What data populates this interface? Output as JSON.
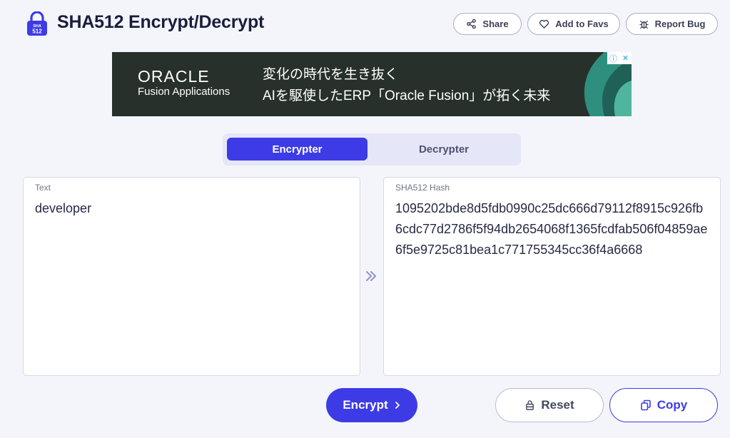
{
  "header": {
    "logo_text_top": "SHA",
    "logo_text_bottom": "512",
    "title": "SHA512 Encrypt/Decrypt",
    "share_label": "Share",
    "favs_label": "Add to Favs",
    "bug_label": "Report Bug"
  },
  "ad": {
    "brand_line1": "ORACLE",
    "brand_line2": "Fusion Applications",
    "text_line1": "変化の時代を生き抜く",
    "text_line2": "AIを駆使したERP「Oracle Fusion」が拓く未来",
    "info_icon": "ⓘ",
    "close_icon": "✕"
  },
  "tabs": [
    {
      "label": "Encrypter",
      "active": true
    },
    {
      "label": "Decrypter",
      "active": false
    }
  ],
  "input_panel": {
    "label": "Text",
    "value": "developer"
  },
  "output_panel": {
    "label": "SHA512 Hash",
    "value": "1095202bde8d5fdb0990c25dc666d79112f8915c926fb6cdc77d2786f5f94db2654068f1365fcdfab506f04859ae6f5e9725c81bea1c771755345cc36f4a6668"
  },
  "actions": {
    "encrypt_label": "Encrypt",
    "reset_label": "Reset",
    "copy_label": "Copy"
  },
  "colors": {
    "accent": "#3d3be6",
    "background": "#f4f5fb",
    "ad_background": "#27302b"
  }
}
